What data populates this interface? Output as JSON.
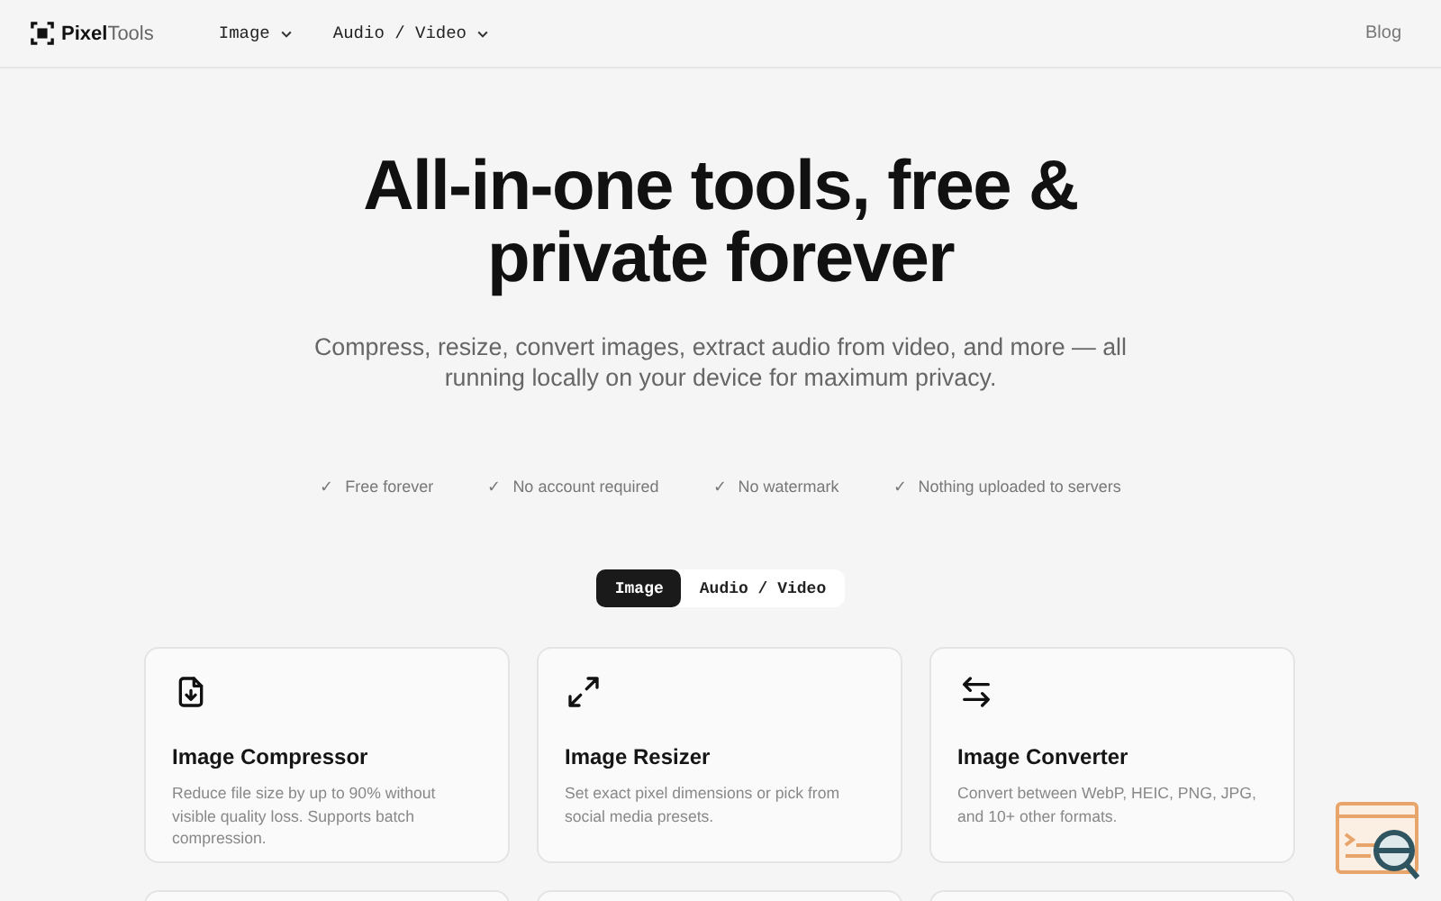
{
  "header": {
    "logo": {
      "bold": "Pixel",
      "light": "Tools"
    },
    "nav": [
      {
        "label": "Image"
      },
      {
        "label": "Audio / Video"
      }
    ],
    "right_link": "Blog"
  },
  "hero": {
    "title": "All-in-one tools, free & private forever",
    "subtitle": "Compress, resize, convert images, extract audio from video, and more — all running locally on your device for maximum privacy."
  },
  "features": [
    {
      "mark": "✓",
      "label": "Free forever"
    },
    {
      "mark": "✓",
      "label": "No account required"
    },
    {
      "mark": "✓",
      "label": "No watermark"
    },
    {
      "mark": "✓",
      "label": "Nothing uploaded to servers"
    }
  ],
  "tabs": [
    {
      "label": "Image",
      "selected": true
    },
    {
      "label": "Audio / Video",
      "selected": false
    }
  ],
  "cards": [
    {
      "kind": "compress",
      "title": "Image Compressor",
      "description": "Reduce file size by up to 90% without visible quality loss. Supports batch compression."
    },
    {
      "kind": "resize",
      "title": "Image Resizer",
      "description": "Set exact pixel dimensions or pick from social media presets."
    },
    {
      "kind": "convert",
      "title": "Image Converter",
      "description": "Convert between WebP, HEIC, PNG, JPG, and 10+ other formats."
    },
    {
      "kind": "partial"
    },
    {
      "kind": "partial"
    },
    {
      "kind": "partial"
    }
  ]
}
